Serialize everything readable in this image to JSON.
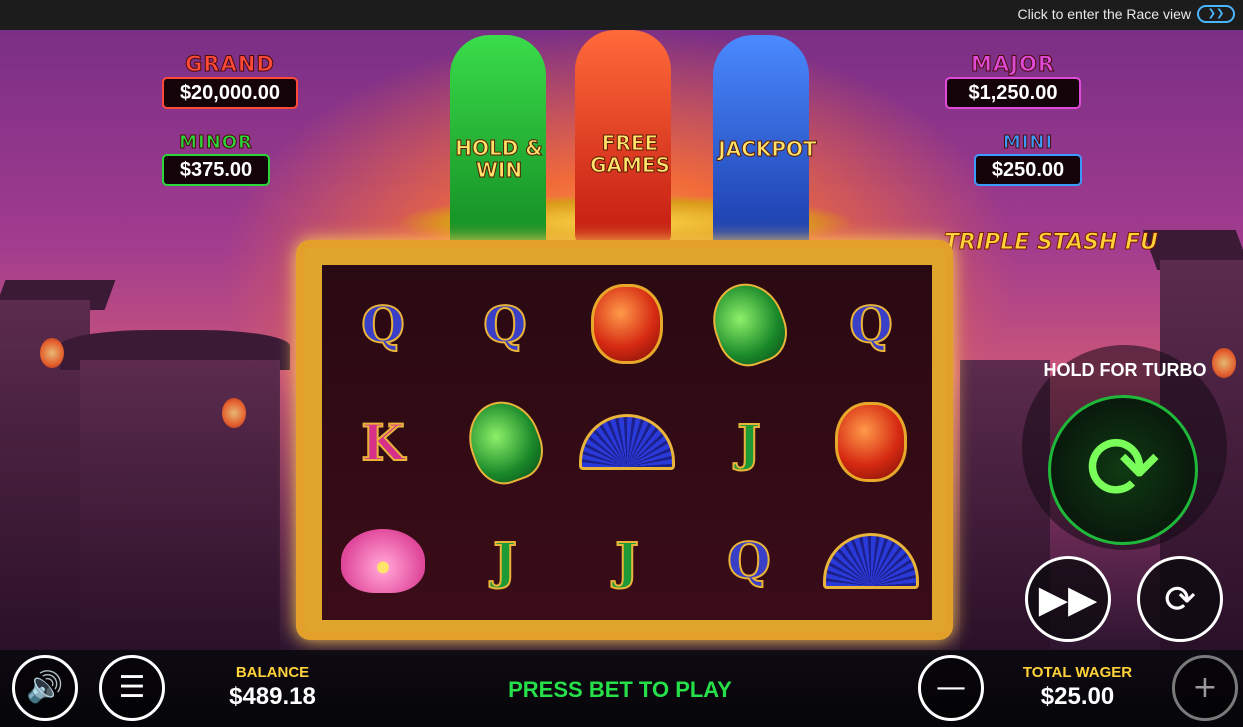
{
  "topbar": {
    "race_text": "Click to enter the Race view",
    "race_toggle_icon": "double-chevron-right-icon"
  },
  "jackpots": {
    "grand": {
      "title": "GRAND",
      "value": "$20,000.00",
      "color": "#ff4a3a"
    },
    "major": {
      "title": "MAJOR",
      "value": "$1,250.00",
      "color": "#e04ad8"
    },
    "minor": {
      "title": "MINOR",
      "value": "$375.00",
      "color": "#2ad83a"
    },
    "mini": {
      "title": "MINI",
      "value": "$250.00",
      "color": "#3a9aff"
    }
  },
  "features": {
    "hold_win": "HOLD & WIN",
    "free_games": "FREE GAMES",
    "jackpot": "JACKPOT"
  },
  "logo": "TRIPLE STASH FU",
  "reels": [
    [
      "Q",
      "Q",
      "lantern",
      "koi",
      "Q"
    ],
    [
      "K",
      "koi",
      "fan",
      "J",
      "lantern"
    ],
    [
      "lotus",
      "J",
      "J",
      "Q",
      "fan"
    ]
  ],
  "turbo": {
    "label": "HOLD FOR TURBO",
    "icon": "refresh-icon"
  },
  "buttons": {
    "fast_icon": "fast-forward-icon",
    "autoplay_icon": "autoplay-icon",
    "sound_icon": "speaker-icon",
    "menu_icon": "menu-icon",
    "minus_icon": "minus-icon",
    "plus_icon": "plus-icon"
  },
  "bottom": {
    "balance_label": "BALANCE",
    "balance_value": "$489.18",
    "press_text": "PRESS BET TO PLAY",
    "wager_label": "TOTAL WAGER",
    "wager_value": "$25.00"
  }
}
